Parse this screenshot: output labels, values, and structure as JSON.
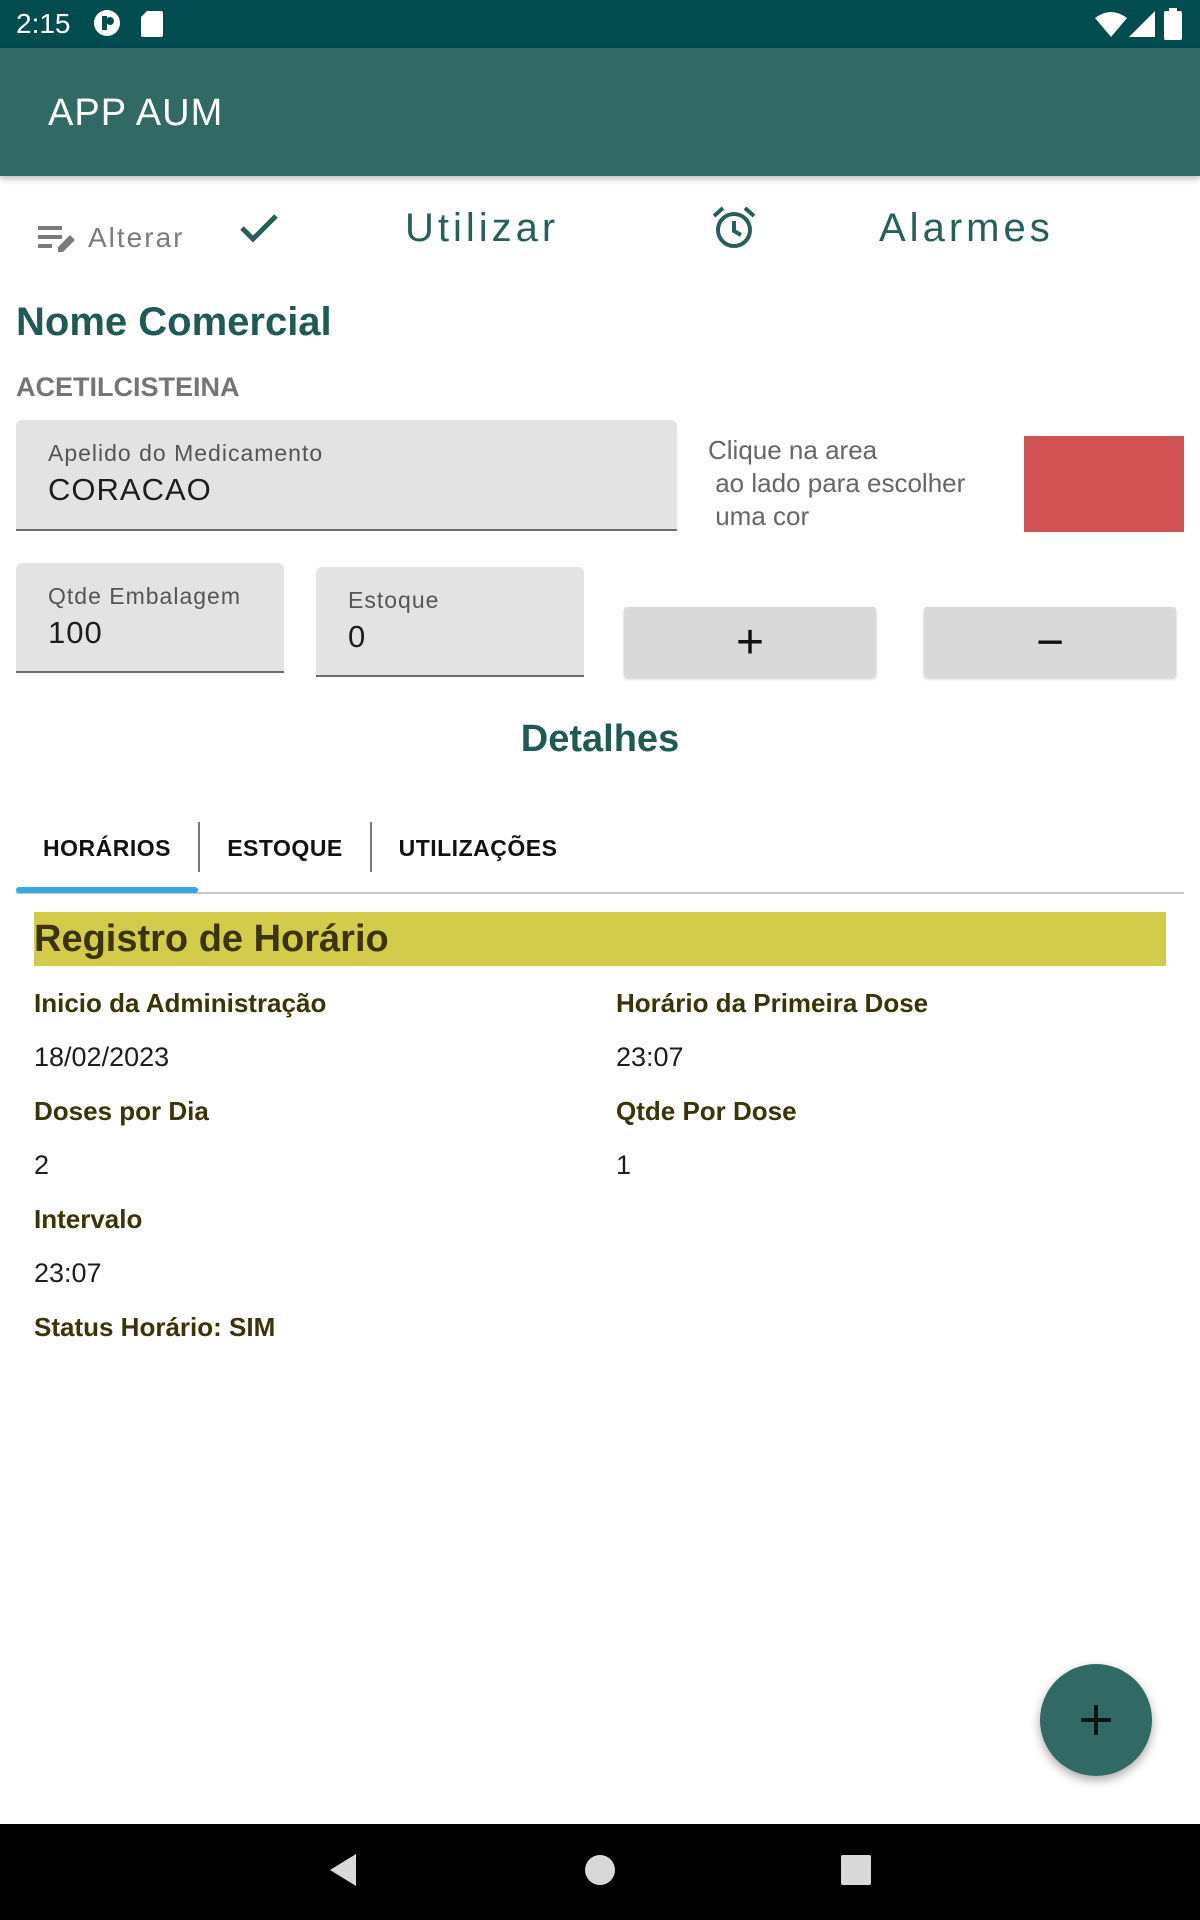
{
  "status_bar": {
    "time": "2:15"
  },
  "app_bar": {
    "title": "APP AUM"
  },
  "toolbar": {
    "alterar_label": "Alterar",
    "utilizar_label": "Utilizar",
    "alarmes_label": "Alarmes"
  },
  "header": {
    "title": "Nome Comercial",
    "medication_name": "ACETILCISTEINA"
  },
  "fields": {
    "apelido": {
      "label": "Apelido do Medicamento",
      "value": "CORACAO"
    },
    "qtde_embalagem": {
      "label": "Qtde Embalagem",
      "value": "100"
    },
    "estoque": {
      "label": "Estoque",
      "value": "0"
    }
  },
  "color_picker": {
    "hint": "Clique na area\n ao lado para escolher\n uma cor",
    "color": "#d05252"
  },
  "stepper": {
    "plus": "+",
    "minus": "−"
  },
  "details": {
    "title": "Detalhes"
  },
  "tabs": [
    {
      "label": "HORÁRIOS",
      "selected": true
    },
    {
      "label": "ESTOQUE",
      "selected": false
    },
    {
      "label": "UTILIZAÇÕES",
      "selected": false
    }
  ],
  "record": {
    "title": "Registro de Horário",
    "inicio_label": "Inicio da Administração",
    "inicio_value": "18/02/2023",
    "primeira_dose_label": "Horário da Primeira Dose",
    "primeira_dose_value": "23:07",
    "doses_label": "Doses por Dia",
    "doses_value": "2",
    "qtde_dose_label": "Qtde Por Dose",
    "qtde_dose_value": "1",
    "intervalo_label": "Intervalo",
    "intervalo_value": "23:07",
    "status": "Status Horário: SIM"
  },
  "fab": {
    "icon": "plus-icon"
  },
  "colors": {
    "primary": "#316a65",
    "status_bar": "#004c4f",
    "accent": "#35a7e3",
    "banner": "#d3cc4a"
  }
}
